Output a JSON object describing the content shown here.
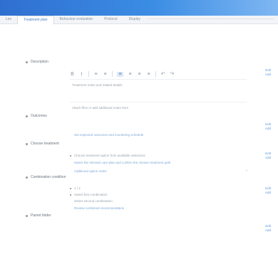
{
  "tabs": [
    {
      "label": "Les",
      "active": false
    },
    {
      "label": "Treatment plan",
      "active": true
    },
    {
      "label": "Behaviour evaluation",
      "active": false
    },
    {
      "label": "Protocol",
      "active": false
    },
    {
      "label": "Display",
      "active": false
    }
  ],
  "sections": {
    "description": "Description",
    "outcomes": "Outcomes",
    "choose_treatment": "Choose treatment",
    "combination_condition": "Combination condition",
    "parent_folder": "Parent folder"
  },
  "side_actions": {
    "description": [
      "Edit",
      "Add"
    ],
    "outcomes": [
      "Edit",
      "Add"
    ],
    "choose_treatment": [
      "Edit",
      "Add"
    ],
    "combination_condition": [
      "Edit",
      "Add"
    ],
    "parent_folder": [
      "Edit",
      "Add"
    ]
  },
  "toolbar": {
    "bold": "B",
    "italic": "I",
    "list1": "≡",
    "list2": "≡",
    "align_left": "≡",
    "align_center": "≡",
    "align_right": "≡",
    "justify": "≡",
    "undo": "↶",
    "redo": "↷"
  },
  "editor": {
    "line1": "Treatment notes and related details",
    "line2": "Attach files or add additional notes here"
  },
  "outcomes": {
    "line1": "Set expected outcomes and monitoring schedule"
  },
  "choose_treatment": {
    "item1": "Choose treatment option from available selections",
    "item2": "Select the relevant care plan and confirm the chosen treatment path",
    "item3": "Additional option notes"
  },
  "combination": {
    "item1": "1 / 2",
    "item2": "Select first combination",
    "item3": "Select second combination",
    "item4": "Review combined recommendation"
  }
}
